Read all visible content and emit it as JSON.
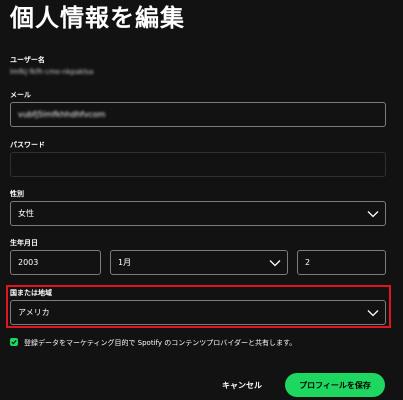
{
  "page_title": "個人情報を編集",
  "username": {
    "label": "ユーザー名",
    "value": "lmfkj·fkfh·cmo·nkpaklsa"
  },
  "email": {
    "label": "メール",
    "value": "vubfj5lmfkhhdhfvcom"
  },
  "password": {
    "label": "パスワード",
    "value": ""
  },
  "gender": {
    "label": "性別",
    "value": "女性"
  },
  "birthdate": {
    "label": "生年月日",
    "year": "2003",
    "month": "1月",
    "day": "2"
  },
  "country": {
    "label": "国または地域",
    "value": "アメリカ"
  },
  "consent": {
    "checked": true,
    "text": "登録データをマーケティング目的で Spotify のコンテンツプロバイダーと共有します。"
  },
  "actions": {
    "cancel": "キャンセル",
    "save": "プロフィールを保存"
  },
  "colors": {
    "accent": "#1ed760",
    "highlight": "#e0161e",
    "background": "#121212"
  },
  "icons": {
    "dropdown": "chevron-down-icon",
    "check": "check-icon"
  }
}
